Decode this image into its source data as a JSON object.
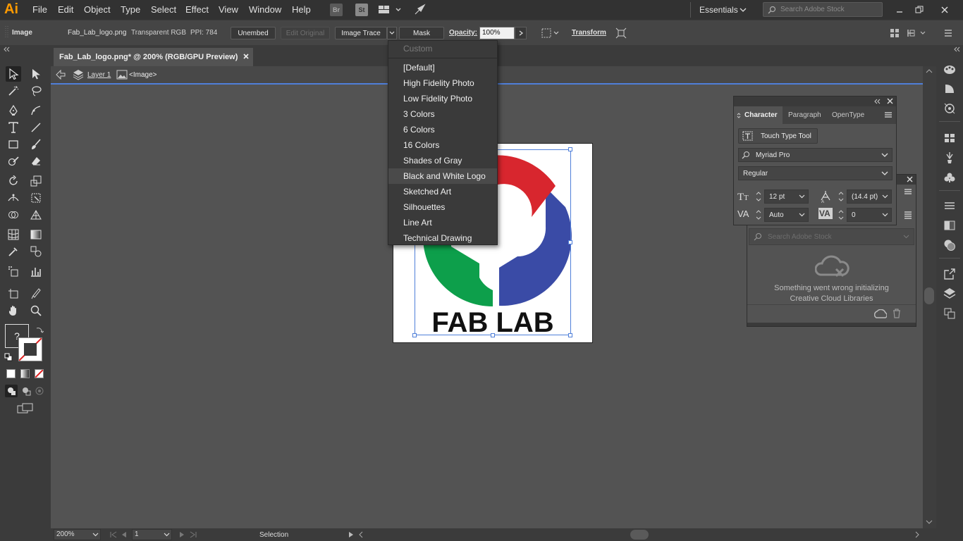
{
  "app": {
    "logo": "Ai"
  },
  "menu": {
    "items": [
      "File",
      "Edit",
      "Object",
      "Type",
      "Select",
      "Effect",
      "View",
      "Window",
      "Help"
    ],
    "bridge": "Br",
    "stock": "St"
  },
  "workspace": {
    "label": "Essentials",
    "search_placeholder": "Search Adobe Stock"
  },
  "control": {
    "object_type": "Image",
    "filename": "Fab_Lab_logo.png",
    "color_mode": "Transparent RGB",
    "ppi": "PPI: 784",
    "unembed": "Unembed",
    "edit_original": "Edit Original",
    "image_trace": "Image Trace",
    "mask": "Mask",
    "opacity_label": "Opacity:",
    "opacity_value": "100%",
    "transform": "Transform"
  },
  "document": {
    "tab_title": "Fab_Lab_logo.png* @ 200% (RGB/GPU Preview)",
    "layer": "Layer 1",
    "object": "<Image>"
  },
  "trace_menu": {
    "header": "Custom",
    "items": [
      "[Default]",
      "High Fidelity Photo",
      "Low Fidelity Photo",
      "3 Colors",
      "6 Colors",
      "16 Colors",
      "Shades of Gray",
      "Black and White Logo",
      "Sketched Art",
      "Silhouettes",
      "Line Art",
      "Technical Drawing"
    ],
    "highlighted": "Black and White Logo"
  },
  "character_panel": {
    "tabs": [
      "Character",
      "Paragraph",
      "OpenType"
    ],
    "touch_type": "Touch Type Tool",
    "font_family": "Myriad Pro",
    "font_style": "Regular",
    "font_size": "12 pt",
    "leading": "(14.4 pt)",
    "kerning": "Auto",
    "tracking": "0"
  },
  "cc_libraries": {
    "search_placeholder": "Search Adobe Stock",
    "error_line1": "Something went wrong initializing",
    "error_line2": "Creative Cloud Libraries"
  },
  "artwork": {
    "logo_text": "FAB LAB",
    "colors": {
      "red": "#d8262e",
      "green": "#0d9f4b",
      "blue": "#3a4ba6"
    }
  },
  "status": {
    "zoom": "200%",
    "page": "1",
    "tool": "Selection"
  },
  "colors": {
    "accent": "#4f7fd9",
    "ai_orange": "#ff9a00"
  }
}
